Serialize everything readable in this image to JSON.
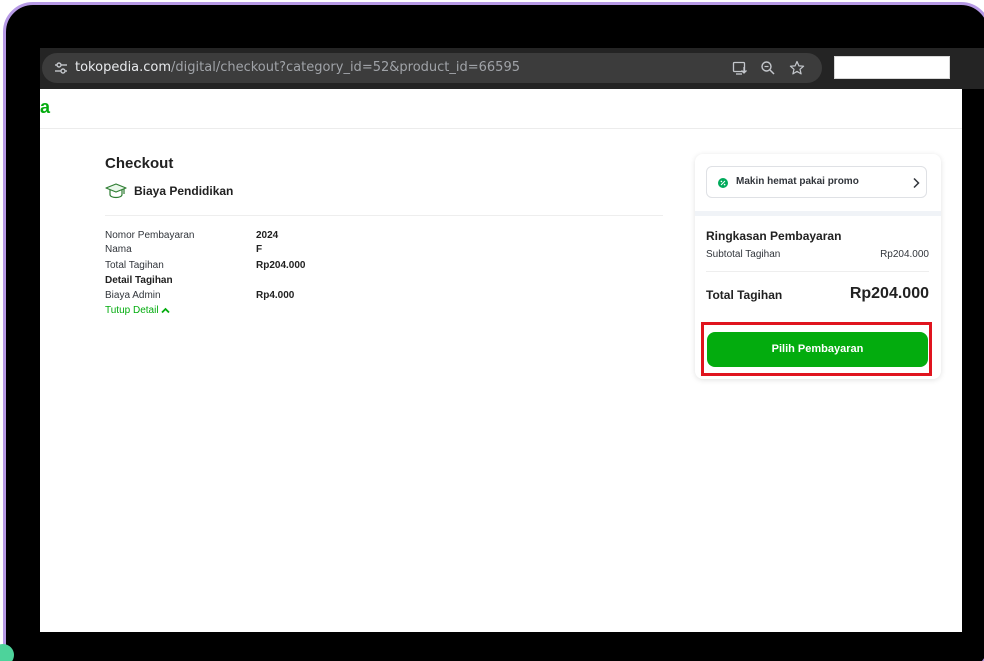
{
  "browser": {
    "url_domain": "tokopedia.com",
    "url_path": "/digital/checkout?category_id=52&product_id=66595"
  },
  "header": {
    "logo_fragment": "a"
  },
  "checkout": {
    "title": "Checkout",
    "product_icon": "graduation-cap-icon",
    "product_name": "Biaya Pendidikan",
    "rows": [
      {
        "label": "Nomor Pembayaran",
        "value": "2024"
      },
      {
        "label": "Nama",
        "value": "F"
      },
      {
        "label": "Total Tagihan",
        "value": "Rp204.000"
      },
      {
        "label": "Detail Tagihan",
        "value": ""
      },
      {
        "label": "Biaya Admin",
        "value": "Rp4.000"
      }
    ],
    "toggle_label": "Tutup Detail"
  },
  "summary": {
    "promo_label": "Makin hemat pakai promo",
    "title": "Ringkasan Pembayaran",
    "subtotal_label": "Subtotal Tagihan",
    "subtotal_value": "Rp204.000",
    "total_label": "Total Tagihan",
    "total_value": "Rp204.000",
    "pay_button_label": "Pilih Pembayaran"
  },
  "colors": {
    "brand_green": "#03ac0e",
    "highlight_red": "#e0141e",
    "frame_border": "#b79ae6"
  }
}
